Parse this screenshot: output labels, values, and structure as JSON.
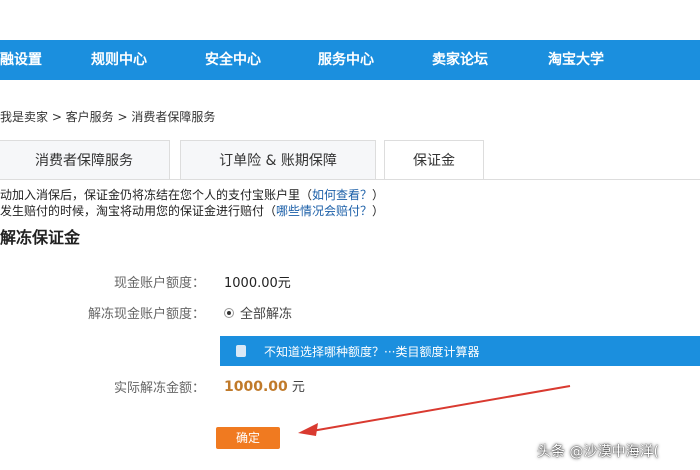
{
  "nav": {
    "items": [
      "融设置",
      "规则中心",
      "安全中心",
      "服务中心",
      "卖家论坛",
      "淘宝大学"
    ]
  },
  "breadcrumb": "我是卖家 > 客户服务 > 消费者保障服务",
  "tabs": [
    {
      "label": "消费者保障服务"
    },
    {
      "label": "订单险 & 账期保障"
    },
    {
      "label": "保证金"
    }
  ],
  "notes": {
    "line1_text": "动加入消保后，保证金仍将冻结在您个人的支付宝账户里（",
    "line1_link": "如何查看？",
    "line1_end": "）",
    "line2_text": "发生赔付的时候，淘宝将动用您的保证金进行赔付（",
    "line2_link": "哪些情况会赔付？",
    "line2_end": "）"
  },
  "section_title": "解冻保证金",
  "form": {
    "cash_label": "现金账户额度：",
    "cash_value": "1000.00元",
    "unfreeze_label": "解冻现金账户额度：",
    "unfreeze_option": "全部解冻",
    "info_text": "不知道选择哪种额度？···类目额度计算器",
    "actual_label": "实际解冻金额：",
    "actual_amount": "1000.00",
    "actual_unit": " 元",
    "confirm_label": "确定"
  },
  "watermark": "头条 @沙漠中海洋(",
  "colors": {
    "nav_blue": "#1b8fde",
    "confirm_orange": "#f07a20",
    "amount_color": "#c07a2a",
    "arrow_red": "#d93a30"
  }
}
